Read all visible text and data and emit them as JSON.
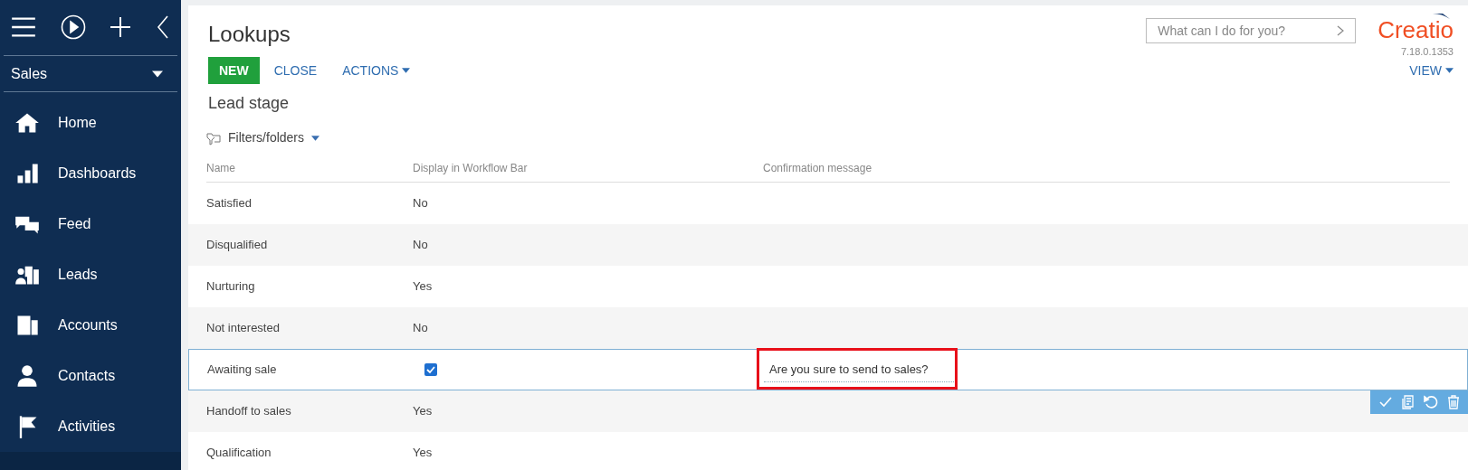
{
  "sidebar": {
    "workplace": "Sales",
    "items": [
      {
        "label": "Home",
        "kind": "home"
      },
      {
        "label": "Dashboards",
        "kind": "chart"
      },
      {
        "label": "Feed",
        "kind": "feed"
      },
      {
        "label": "Leads",
        "kind": "leads"
      },
      {
        "label": "Accounts",
        "kind": "accounts"
      },
      {
        "label": "Contacts",
        "kind": "contact"
      },
      {
        "label": "Activities",
        "kind": "flag"
      }
    ]
  },
  "page": {
    "title": "Lookups",
    "search": {
      "placeholder": "What can I do for you?"
    },
    "logo": "Creatio",
    "version": "7.18.0.1353",
    "buttons": [
      {
        "label": "NEW",
        "kind": "primary"
      },
      {
        "label": "CLOSE",
        "kind": "link"
      },
      {
        "label": "ACTIONS",
        "kind": "menu"
      }
    ],
    "view": "VIEW",
    "subtitle": "Lead stage",
    "filters": "Filters/folders"
  },
  "table": {
    "columns": [
      "Name",
      "Display in Workflow Bar",
      "Confirmation message"
    ],
    "rows": [
      {
        "name": "Satisfied",
        "display": "No",
        "selected": false
      },
      {
        "name": "Disqualified",
        "display": "No",
        "selected": false
      },
      {
        "name": "Nurturing",
        "display": "Yes",
        "selected": false
      },
      {
        "name": "Not interested",
        "display": "No",
        "selected": false
      },
      {
        "name": "Awaiting sale",
        "checked": true,
        "message": "Are you sure to send to sales?",
        "highlighted": true,
        "selected": true
      },
      {
        "name": "Handoff to sales",
        "display": "Yes",
        "selected": false
      },
      {
        "name": "Qualification",
        "display": "Yes",
        "selected": false
      }
    ]
  }
}
